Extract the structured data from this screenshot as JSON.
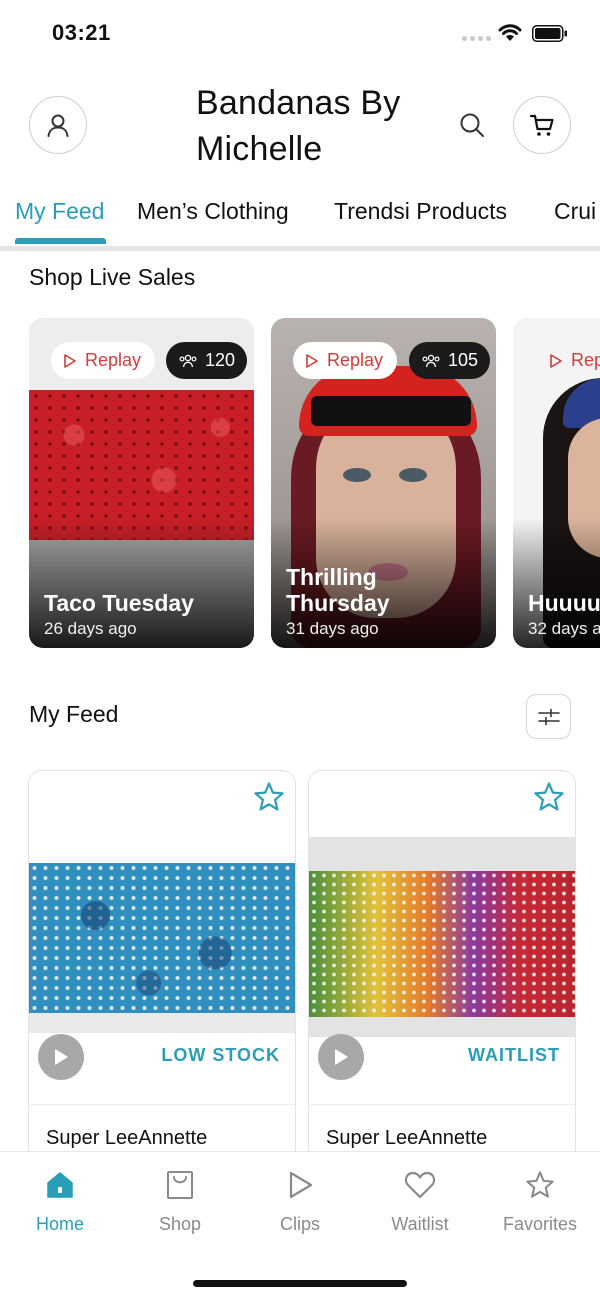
{
  "status_bar": {
    "time": "03:21"
  },
  "header": {
    "store_name": "Bandanas By Michelle"
  },
  "tabs": [
    {
      "label": "My Feed",
      "active": true
    },
    {
      "label": "Men’s Clothing",
      "active": false
    },
    {
      "label": "Trendsi Products",
      "active": false
    },
    {
      "label": "Crui",
      "active": false
    }
  ],
  "live_section": {
    "title": "Shop Live Sales",
    "cards": [
      {
        "replay_label": "Replay",
        "viewers": "120",
        "title": "Taco Tuesday",
        "time": "26 days ago"
      },
      {
        "replay_label": "Replay",
        "viewers": "105",
        "title": "Thrilling Thursday",
        "time": "31 days ago"
      },
      {
        "replay_label": "Rep",
        "viewers": "",
        "title": "Huuuu pp Daa",
        "time": "32 days a"
      }
    ]
  },
  "feed_section": {
    "title": "My Feed",
    "products": [
      {
        "stock_label": "LOW STOCK",
        "seller": "Super LeeAnnette"
      },
      {
        "stock_label": "WAITLIST",
        "seller": "Super LeeAnnette"
      }
    ]
  },
  "bottom_nav": [
    {
      "label": "Home",
      "icon": "home-icon",
      "active": true
    },
    {
      "label": "Shop",
      "icon": "shopping-bag-icon",
      "active": false
    },
    {
      "label": "Clips",
      "icon": "play-icon",
      "active": false
    },
    {
      "label": "Waitlist",
      "icon": "heart-icon",
      "active": false
    },
    {
      "label": "Favorites",
      "icon": "star-icon",
      "active": false
    }
  ],
  "colors": {
    "accent": "#2a9db8",
    "replay_text": "#d23c3c",
    "inactive_nav": "#8a8a8a"
  }
}
